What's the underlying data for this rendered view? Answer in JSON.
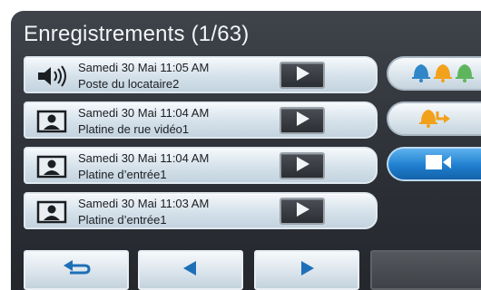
{
  "header": {
    "title": "Enregistrements (1/63)"
  },
  "recordings": [
    {
      "icon": "speaker-icon",
      "date": "Samedi 30 Mai 11:05 AM",
      "name": "Poste du locataire2"
    },
    {
      "icon": "person-video-icon",
      "date": "Samedi 30 Mai 11:04 AM",
      "name": "Platine de rue vidéo1"
    },
    {
      "icon": "person-video-icon",
      "date": "Samedi 30 Mai 11:04 AM",
      "name": "Platine d’entrée1"
    },
    {
      "icon": "person-video-icon",
      "date": "Samedi 30 Mai 11:03 AM",
      "name": "Platine d’entrée1"
    }
  ],
  "side_buttons": [
    {
      "icon": "bells-icon",
      "selected": false
    },
    {
      "icon": "bell-transfer-icon",
      "selected": false
    },
    {
      "icon": "video-camera-icon",
      "selected": true
    }
  ],
  "bottom_nav": [
    {
      "icon": "back-arrow-icon"
    },
    {
      "icon": "left-arrow-icon"
    },
    {
      "icon": "right-arrow-icon"
    },
    {
      "icon": "blank"
    }
  ],
  "colors": {
    "background": "#2c3036",
    "row": "#d5e1ea",
    "accent_blue": "#1f7fcf",
    "bell_blue": "#2f86c8",
    "bell_orange": "#f2a11a",
    "bell_green": "#5fb55c",
    "arrow_blue": "#1e6fb8"
  }
}
